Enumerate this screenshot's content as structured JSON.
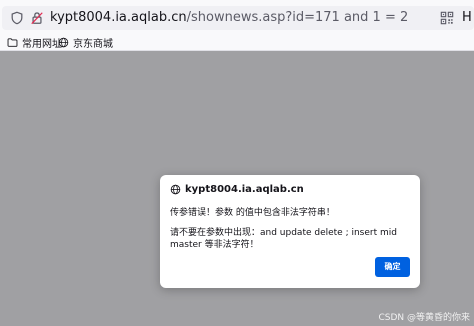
{
  "toolbar": {
    "url_host": "kypt8004.ia.aqlab.cn",
    "url_path": "/shownews.asp?id=171 and 1 = 2",
    "url_right_fragment": "H",
    "icons": [
      "shield-icon",
      "lock-icon",
      "qr-code-icon"
    ]
  },
  "bookmarks": {
    "items": [
      {
        "label": "常用网址",
        "icon": "folder-icon"
      },
      {
        "label": "京东商城",
        "icon": "globe-icon"
      }
    ]
  },
  "dialog": {
    "title": "kypt8004.ia.aqlab.cn",
    "title_icon": "globe-icon",
    "message_line1": "传参错误！参数 的值中包含非法字符串！",
    "message_line2": "请不要在参数中出现：and update delete ; insert mid master 等非法字符！",
    "ok_label": "确定",
    "accent_color": "#0061e0"
  },
  "overlay_color": "#a0a0a3",
  "watermark": "CSDN @等黄昏的你来"
}
